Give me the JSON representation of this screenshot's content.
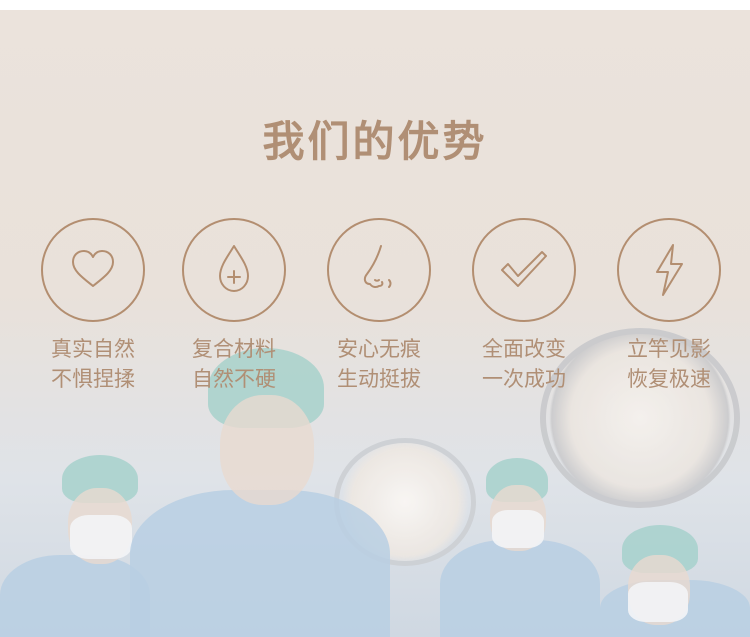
{
  "title": "我们的优势",
  "features": [
    {
      "icon": "heart-icon",
      "line1": "真实自然",
      "line2": "不惧捏揉"
    },
    {
      "icon": "droplet-plus-icon",
      "line1": "复合材料",
      "line2": "自然不硬"
    },
    {
      "icon": "nose-icon",
      "line1": "安心无痕",
      "line2": "生动挺拔"
    },
    {
      "icon": "checkmark-icon",
      "line1": "全面改变",
      "line2": "一次成功"
    },
    {
      "icon": "lightning-icon",
      "line1": "立竿见影",
      "line2": "恢复极速"
    }
  ],
  "colors": {
    "accent": "#b08f75",
    "background": "#ebe3dc"
  }
}
